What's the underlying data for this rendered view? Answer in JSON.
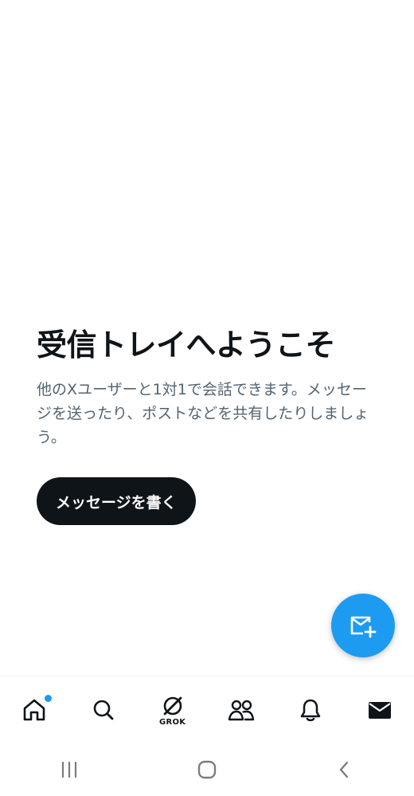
{
  "inbox": {
    "title": "受信トレイへようこそ",
    "description": "他のXユーザーと1対1で会話できます。メッセージを送ったり、ポストなどを共有したりしましょう。",
    "write_button": "メッセージを書く"
  },
  "fab": {
    "icon": "new-message-icon",
    "color": "#1d9bf0"
  },
  "bottom_nav": {
    "items": [
      {
        "icon": "home-icon",
        "has_notification_dot": true
      },
      {
        "icon": "search-icon"
      },
      {
        "icon": "grok-icon",
        "label": "GROK"
      },
      {
        "icon": "communities-icon"
      },
      {
        "icon": "bell-icon"
      },
      {
        "icon": "mail-icon",
        "active": true
      }
    ]
  },
  "system_nav": {
    "items": [
      "recent-apps-icon",
      "home-button-icon",
      "back-icon"
    ]
  },
  "colors": {
    "primary_text": "#0f1419",
    "secondary_text": "#536471",
    "accent": "#1d9bf0",
    "button_bg": "#0f1419"
  }
}
